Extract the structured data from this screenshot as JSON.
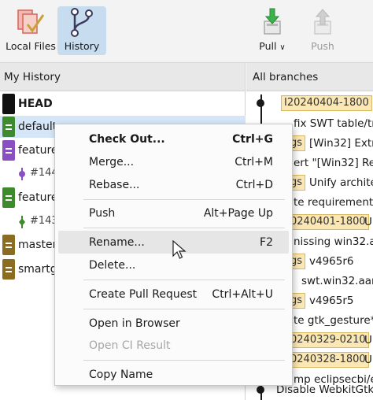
{
  "toolbar": {
    "local_files": "Local Files",
    "history": "History",
    "pull": "Pull",
    "pull_arrow": "∨",
    "push": "Push"
  },
  "left_panel": {
    "title": "My History",
    "branches": [
      {
        "name": "HEAD",
        "color": "#111111"
      },
      {
        "name": "default",
        "color": "#3e8a2f"
      },
      {
        "name": "feature",
        "color": "#8a4fc0"
      },
      {
        "name": "#144",
        "color": "#8a4fc0"
      },
      {
        "name": "feature",
        "color": "#3e8a2f"
      },
      {
        "name": "#143",
        "color": "#3e8a2f"
      },
      {
        "name": "master",
        "color": "#8a6d20"
      },
      {
        "name": "smartg",
        "color": "#8a6d20"
      }
    ]
  },
  "right_panel": {
    "title": "All branches",
    "commits": [
      {
        "tag": "I20240404-1800",
        "text": ""
      },
      {
        "tag": "",
        "text": "fix SWT table/tr"
      },
      {
        "tag": "gs",
        "text": "[Win32] Extra"
      },
      {
        "tag": "",
        "text": "ert \"[Win32] Re"
      },
      {
        "tag": "gs",
        "text": "Unify archite"
      },
      {
        "tag": "",
        "text": "te requirement"
      },
      {
        "tag": "0240401-1800",
        "text": "U"
      },
      {
        "tag": "",
        "text": "nissing win32.a"
      },
      {
        "tag": "gs",
        "text": "v4965r6"
      },
      {
        "tag": "",
        "text": "swt.win32.aarc"
      },
      {
        "tag": "gs",
        "text": "v4965r5"
      },
      {
        "tag": "",
        "text": "te gtk_gesture*"
      },
      {
        "tag": "0240329-0210",
        "text": "U"
      },
      {
        "tag": "0240328-1800",
        "text": "U"
      },
      {
        "tag": "",
        "text": "mp eclipsecbi/e"
      },
      {
        "tag": "",
        "text": "Disable WebkitGtk"
      }
    ]
  },
  "context_menu": {
    "items": [
      {
        "label": "Check Out...",
        "shortcut": "Ctrl+G"
      },
      {
        "label": "Merge...",
        "shortcut": "Ctrl+M"
      },
      {
        "label": "Rebase...",
        "shortcut": "Ctrl+D"
      },
      {
        "label": "Push",
        "shortcut": "Alt+Page Up"
      },
      {
        "label": "Rename...",
        "shortcut": "F2"
      },
      {
        "label": "Delete...",
        "shortcut": ""
      },
      {
        "label": "Create Pull Request",
        "shortcut": "Ctrl+Alt+U"
      },
      {
        "label": "Open in Browser",
        "shortcut": ""
      },
      {
        "label": "Open CI Result",
        "shortcut": ""
      },
      {
        "label": "Copy Name",
        "shortcut": ""
      }
    ]
  },
  "colors": {
    "accent_selected": "#c8dcf0",
    "tag_background": "#fbe7b3",
    "push_green": "#3eb24a"
  }
}
